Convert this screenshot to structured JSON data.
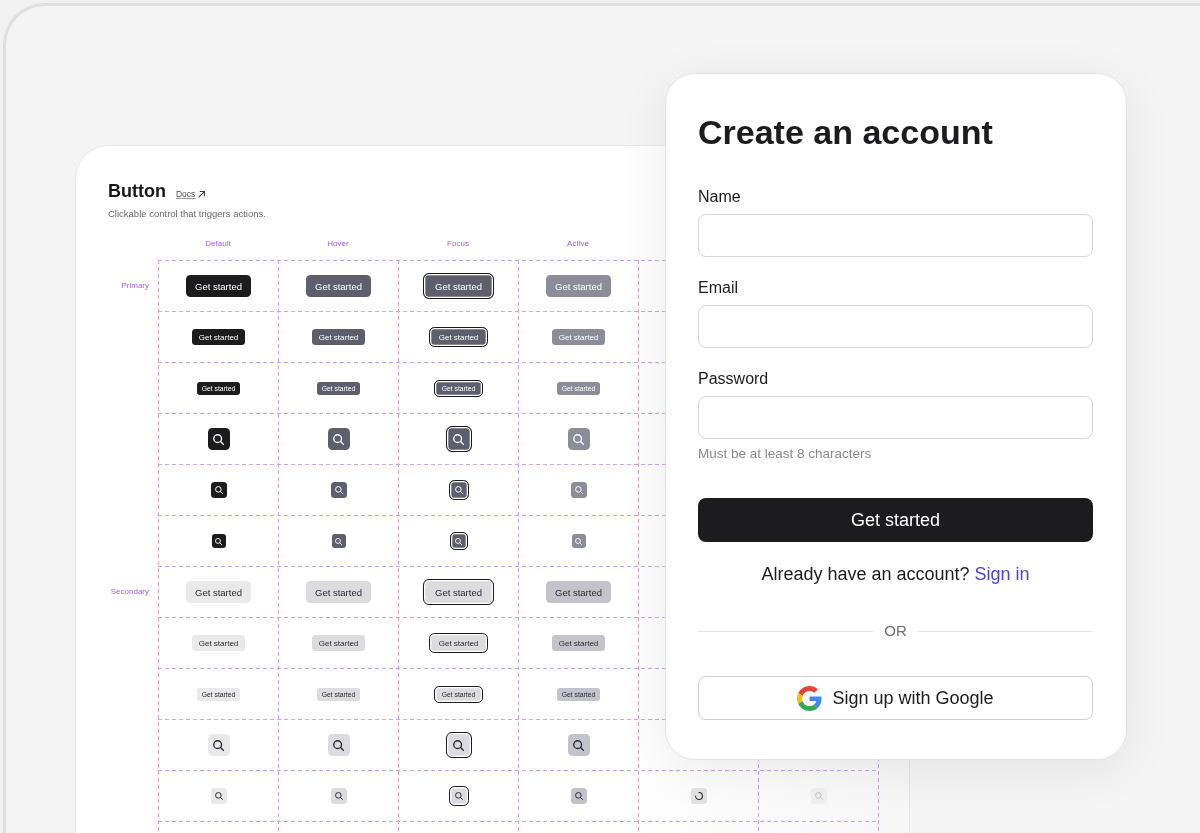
{
  "component_sheet": {
    "title": "Button",
    "docs_link": "Docs",
    "description": "Clickable control that triggers actions.",
    "columns": [
      {
        "label": "Default",
        "kind": "default"
      },
      {
        "label": "Hover",
        "kind": "hover"
      },
      {
        "label": "Focus",
        "kind": "focus"
      },
      {
        "label": "Active",
        "kind": "active"
      },
      {
        "kind": "loading"
      },
      {
        "kind": "disabled"
      }
    ],
    "rows": [
      {
        "group_label": "Primary",
        "kind": "primary",
        "buttons": [
          {
            "kind": "text",
            "label": "Get started"
          },
          {
            "kind": "text",
            "label": "Get started"
          },
          {
            "kind": "text",
            "label": "Get started"
          },
          {
            "kind": "text",
            "label": "Get started"
          }
        ]
      },
      {
        "kind": "primary",
        "buttons": [
          {
            "kind": "text",
            "label": "Get started"
          },
          {
            "kind": "text",
            "label": "Get started"
          },
          {
            "kind": "text",
            "label": "Get started"
          },
          {
            "kind": "text",
            "label": "Get started"
          }
        ]
      },
      {
        "kind": "primary",
        "buttons": [
          {
            "kind": "text",
            "label": "Get started"
          },
          {
            "kind": "text",
            "label": "Get started"
          },
          {
            "kind": "text",
            "label": "Get started"
          },
          {
            "kind": "text",
            "label": "Get started"
          }
        ]
      },
      {
        "kind": "primary",
        "buttons": [
          {
            "kind": "icon"
          },
          {
            "kind": "icon"
          },
          {
            "kind": "icon"
          },
          {
            "kind": "icon"
          }
        ]
      },
      {
        "kind": "primary",
        "buttons": [
          {
            "kind": "icon"
          },
          {
            "kind": "icon"
          },
          {
            "kind": "icon"
          },
          {
            "kind": "icon"
          }
        ]
      },
      {
        "kind": "primary",
        "buttons": [
          {
            "kind": "icon"
          },
          {
            "kind": "icon"
          },
          {
            "kind": "icon"
          },
          {
            "kind": "icon"
          }
        ]
      },
      {
        "group_label": "Secondary",
        "kind": "secondary",
        "buttons": [
          {
            "kind": "text",
            "label": "Get started"
          },
          {
            "kind": "text",
            "label": "Get started"
          },
          {
            "kind": "text",
            "label": "Get started"
          },
          {
            "kind": "text",
            "label": "Get started"
          }
        ]
      },
      {
        "kind": "secondary",
        "buttons": [
          {
            "kind": "text",
            "label": "Get started"
          },
          {
            "kind": "text",
            "label": "Get started"
          },
          {
            "kind": "text",
            "label": "Get started"
          },
          {
            "kind": "text",
            "label": "Get started"
          }
        ]
      },
      {
        "kind": "secondary",
        "buttons": [
          {
            "kind": "text",
            "label": "Get started"
          },
          {
            "kind": "text",
            "label": "Get started"
          },
          {
            "kind": "text",
            "label": "Get started"
          },
          {
            "kind": "text",
            "label": "Get started"
          }
        ]
      },
      {
        "kind": "secondary",
        "buttons": [
          {
            "kind": "icon"
          },
          {
            "kind": "icon"
          },
          {
            "kind": "icon"
          },
          {
            "kind": "icon"
          }
        ]
      },
      {
        "kind": "secondary",
        "buttons": [
          {
            "kind": "icon"
          },
          {
            "kind": "icon"
          },
          {
            "kind": "icon"
          },
          {
            "kind": "icon"
          },
          {
            "kind": "icon"
          },
          {
            "kind": "icon"
          }
        ]
      }
    ]
  },
  "signup_form": {
    "title": "Create an account",
    "fields": [
      {
        "label": "Name"
      },
      {
        "label": "Email"
      },
      {
        "label": "Password",
        "hint": "Must be at least 8 characters"
      }
    ],
    "submit_button": "Get started",
    "signin_prompt": {
      "text": "Already have an account?",
      "link": "Sign in"
    },
    "divider": "OR",
    "google_button": "Sign up with Google"
  }
}
